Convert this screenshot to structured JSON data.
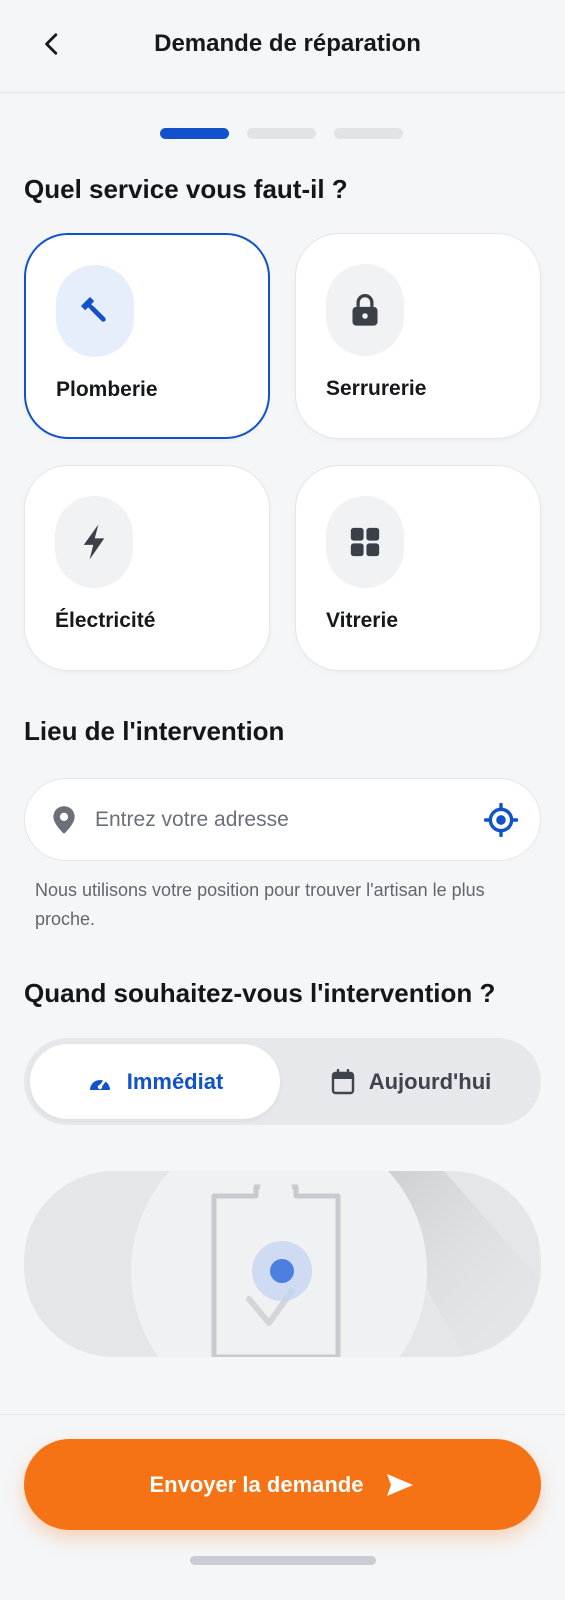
{
  "header": {
    "title": "Demande de réparation",
    "back_icon": "chevron-left-icon"
  },
  "progress": {
    "total_steps": 3,
    "current_step": 1
  },
  "services": {
    "title": "Quel service vous faut-il ?",
    "items": [
      {
        "label": "Plomberie",
        "icon": "wrench-icon",
        "selected": true
      },
      {
        "label": "Serrurerie",
        "icon": "lock-icon",
        "selected": false
      },
      {
        "label": "Électricité",
        "icon": "bolt-icon",
        "selected": false
      },
      {
        "label": "Vitrerie",
        "icon": "grid-icon",
        "selected": false
      }
    ]
  },
  "location": {
    "title": "Lieu de l'intervention",
    "placeholder": "Entrez votre adresse",
    "value": "",
    "helper": "Nous utilisons votre position pour trouver l'artisan le plus proche."
  },
  "timing": {
    "title": "Quand souhaitez-vous l'intervention ?",
    "options": [
      {
        "label": "Immédiat",
        "icon": "speedometer-icon",
        "selected": true
      },
      {
        "label": "Aujourd'hui",
        "icon": "calendar-icon",
        "selected": false
      }
    ]
  },
  "submit": {
    "label": "Envoyer la demande",
    "icon": "send-icon"
  },
  "colors": {
    "accent": "#1152cc",
    "cta": "#f57314",
    "background": "#f5f6f8"
  }
}
